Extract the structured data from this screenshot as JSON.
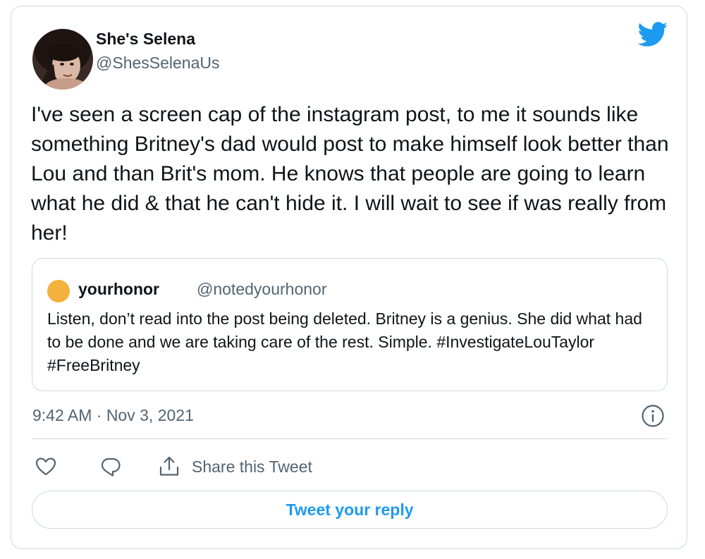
{
  "author": {
    "name": "She's Selena",
    "handle": "@ShesSelenaUs",
    "avatar_icon": "profile-photo"
  },
  "brand": {
    "icon": "twitter-bird-icon",
    "color": "#1d9bf0"
  },
  "tweet": {
    "text": "I've seen a screen cap of the instagram post, to me it sounds like something Britney's dad would post to make himself look better than Lou and than Brit's mom. He knows that people are going to learn what he did & that he can't hide it. I will wait to see if was really from her!"
  },
  "quoted_tweet": {
    "name": "yourhonor",
    "handle": "@notedyourhonor",
    "avatar_color": "#f5b13d",
    "text": "Listen, don’t read into the post being deleted. Britney is a genius. She did what had to be done and we are taking care of the rest. Simple. #InvestigateLouTaylor #FreeBritney"
  },
  "meta": {
    "timestamp": "9:42 AM · Nov 3, 2021",
    "info_icon": "info-icon"
  },
  "actions": {
    "like_icon": "heart-icon",
    "reply_icon": "reply-bubble-icon",
    "share_icon": "share-icon",
    "share_label": "Share this Tweet"
  },
  "reply_button": {
    "label": "Tweet your reply"
  }
}
